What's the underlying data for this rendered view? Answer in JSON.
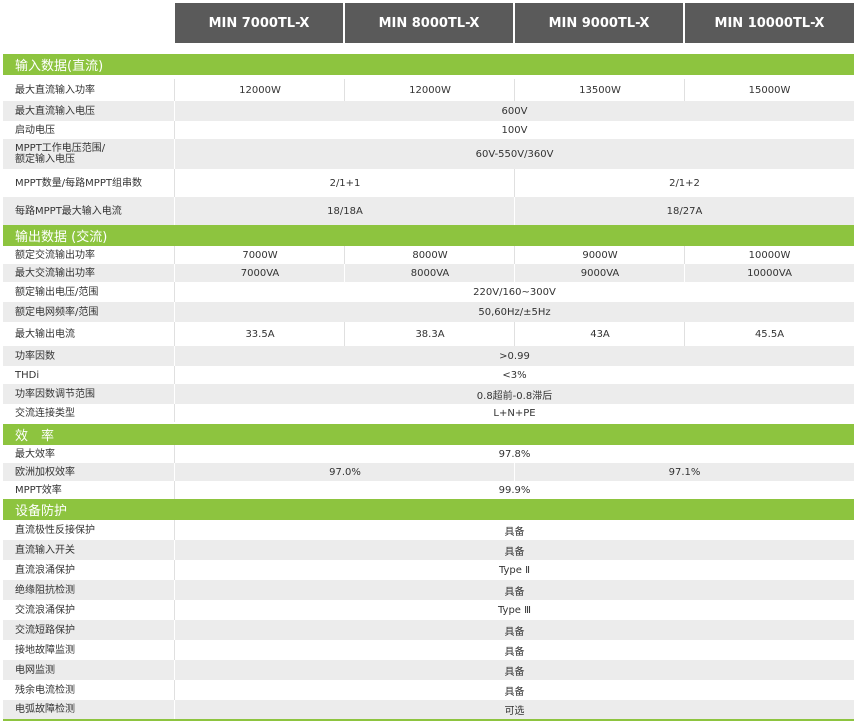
{
  "models": [
    "MIN 7000TL-X",
    "MIN 8000TL-X",
    "MIN 9000TL-X",
    "MIN 10000TL-X"
  ],
  "sections": [
    {
      "title": "输入数据(直流)",
      "rows": [
        {
          "label": "最大直流输入功率",
          "values": [
            "12000W",
            "12000W",
            "13500W",
            "15000W"
          ]
        },
        {
          "label": "最大直流输入电压",
          "values": [
            "600V"
          ]
        },
        {
          "label": "启动电压",
          "values": [
            "100V"
          ]
        },
        {
          "label": "MPPT工作电压范围/\n额定输入电压",
          "values": [
            "60V-550V/360V"
          ]
        },
        {
          "label": "MPPT数量/每路MPPT组串数",
          "values": [
            "2/1+1",
            "2/1+2"
          ]
        },
        {
          "label": "每路MPPT最大输入电流",
          "values": [
            "18/18A",
            "18/27A"
          ]
        }
      ]
    },
    {
      "title": "输出数据 (交流)",
      "rows": [
        {
          "label": "额定交流输出功率",
          "values": [
            "7000W",
            "8000W",
            "9000W",
            "10000W"
          ]
        },
        {
          "label": "最大交流输出功率",
          "values": [
            "7000VA",
            "8000VA",
            "9000VA",
            "10000VA"
          ]
        },
        {
          "label": "额定输出电压/范围",
          "values": [
            "220V/160~300V"
          ]
        },
        {
          "label": "额定电网频率/范围",
          "values": [
            "50,60Hz/±5Hz"
          ]
        },
        {
          "label": "最大输出电流",
          "values": [
            "33.5A",
            "38.3A",
            "43A",
            "45.5A"
          ]
        },
        {
          "label": "功率因数",
          "values": [
            ">0.99"
          ]
        },
        {
          "label": "THDi",
          "values": [
            "<3%"
          ]
        },
        {
          "label": "功率因数调节范围",
          "values": [
            "0.8超前-0.8滞后"
          ]
        },
        {
          "label": "交流连接类型",
          "values": [
            "L+N+PE"
          ]
        }
      ]
    },
    {
      "title": "效　率",
      "rows": [
        {
          "label": "最大效率",
          "values": [
            "97.8%"
          ]
        },
        {
          "label": "欧洲加权效率",
          "values": [
            "97.0%",
            "97.1%"
          ]
        },
        {
          "label": "MPPT效率",
          "values": [
            "99.9%"
          ]
        }
      ]
    },
    {
      "title": "设备防护",
      "rows": [
        {
          "label": "直流极性反接保护",
          "values": [
            "具备"
          ]
        },
        {
          "label": "直流输入开关",
          "values": [
            "具备"
          ]
        },
        {
          "label": "直流浪涌保护",
          "values": [
            "Type Ⅱ"
          ]
        },
        {
          "label": "绝缘阻抗检测",
          "values": [
            "具备"
          ]
        },
        {
          "label": "交流浪涌保护",
          "values": [
            "Type Ⅲ"
          ]
        },
        {
          "label": "交流短路保护",
          "values": [
            "具备"
          ]
        },
        {
          "label": "接地故障监测",
          "values": [
            "具备"
          ]
        },
        {
          "label": "电网监测",
          "values": [
            "具备"
          ]
        },
        {
          "label": "残余电流检测",
          "values": [
            "具备"
          ]
        },
        {
          "label": "电弧故障检测",
          "values": [
            "可选"
          ]
        }
      ]
    }
  ]
}
